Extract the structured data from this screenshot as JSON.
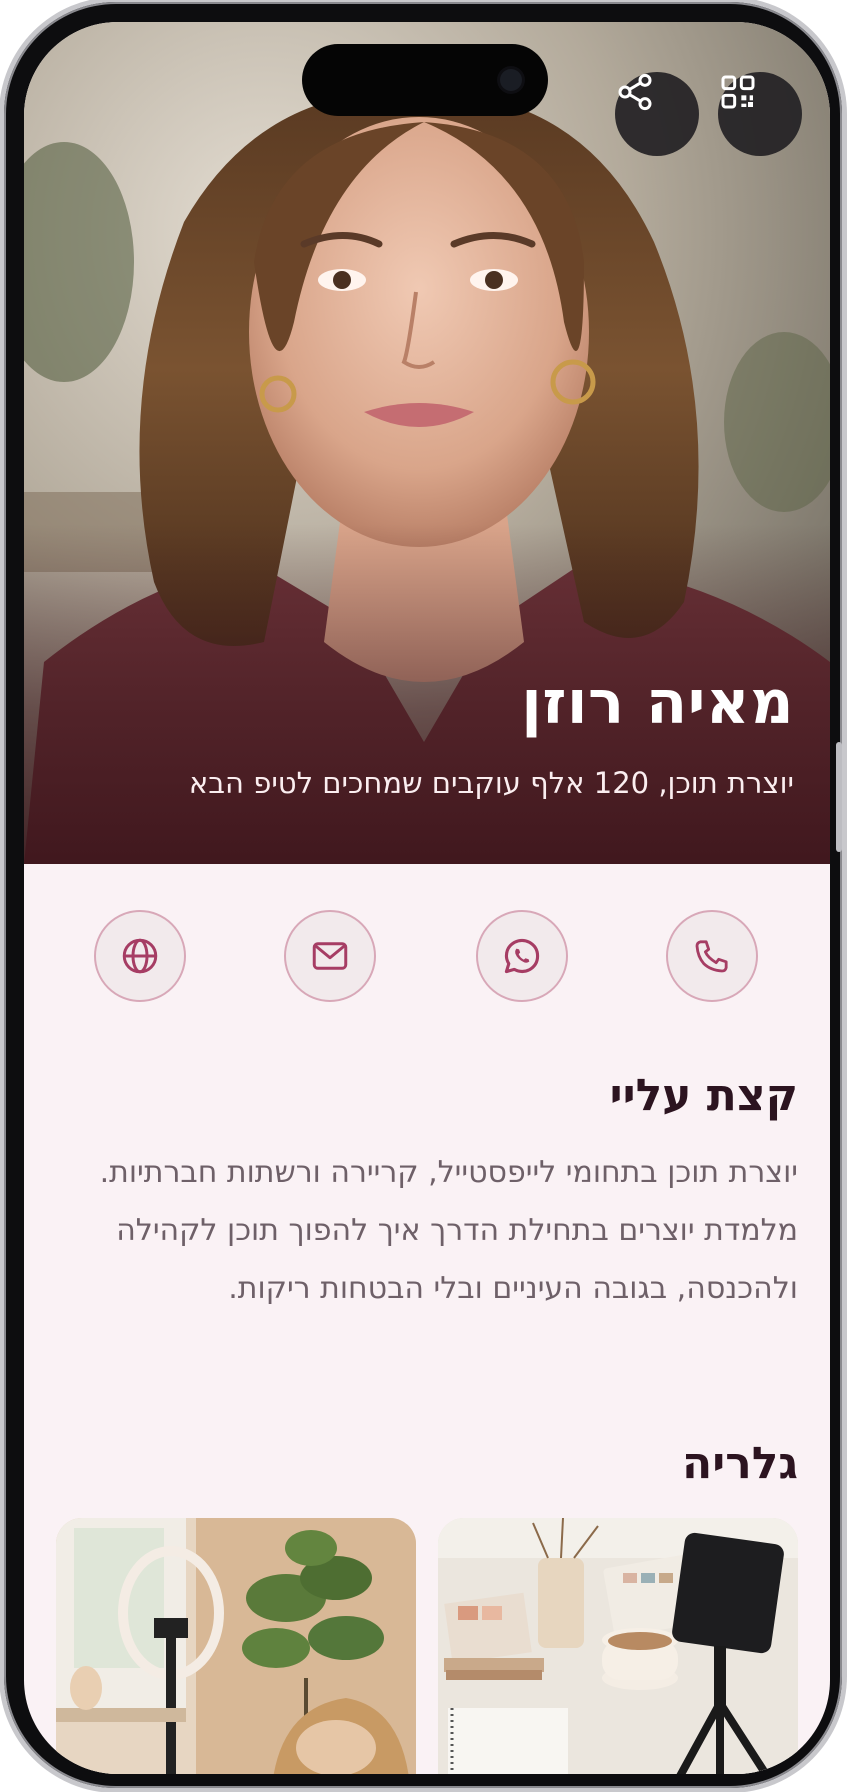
{
  "profile": {
    "name": "מאיה רוזן",
    "tagline": "יוצרת תוכן, 120 אלף עוקבים שמחכים לטיפ הבא",
    "photo_icon": "portrait-photo"
  },
  "header_actions": {
    "share_icon": "share-icon",
    "qr_icon": "qr-code-icon"
  },
  "contacts": [
    {
      "id": "phone",
      "icon": "phone-icon"
    },
    {
      "id": "whatsapp",
      "icon": "whatsapp-icon"
    },
    {
      "id": "email",
      "icon": "mail-icon"
    },
    {
      "id": "website",
      "icon": "globe-icon"
    }
  ],
  "about": {
    "title": "קצת עליי",
    "text": "יוצרת תוכן בתחומי לייפסטייל, קריירה ורשתות חברתיות. מלמדת יוצרים בתחילת הדרך איך להפוך תוכן לקהילה ולהכנסה, בגובה העיניים ובלי הבטחות ריקות."
  },
  "gallery": {
    "title": "גלריה",
    "images": [
      "desk-with-phone-tripod",
      "room-with-ring-light"
    ]
  },
  "colors": {
    "accent": "#a63d64",
    "background": "#faf2f5",
    "contact_border": "#d8a8b8",
    "title": "#2c1420",
    "body_text": "#6e6068"
  }
}
